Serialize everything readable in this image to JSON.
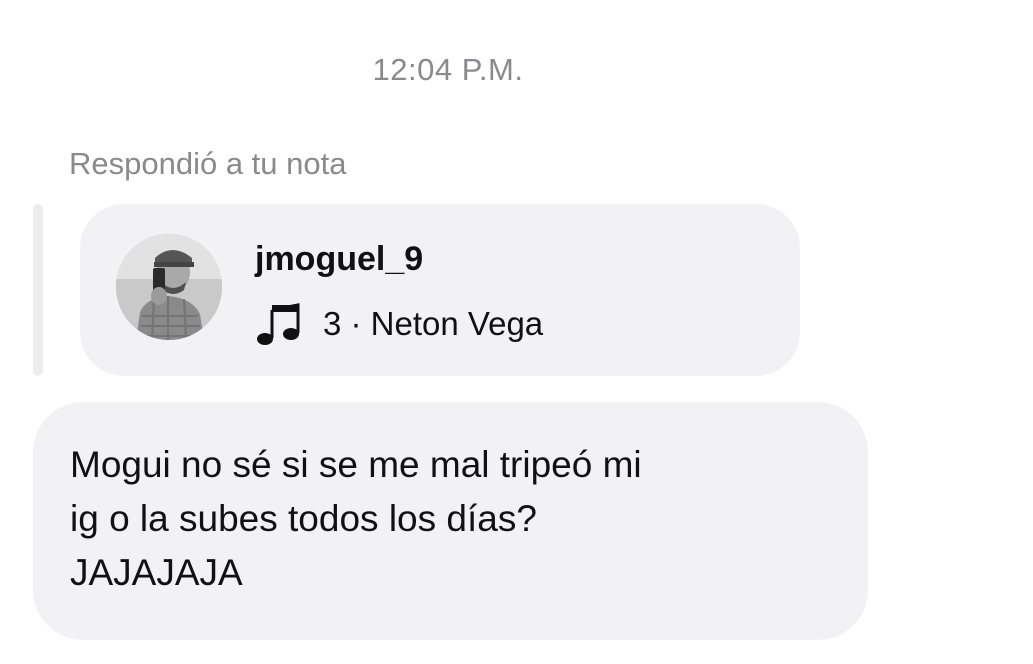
{
  "thread": {
    "timestamp": "12:04 P.M.",
    "reply_context": "Respondió a tu nota"
  },
  "note": {
    "username": "jmoguel_9",
    "music_icon": "musical-note-icon",
    "music_text": "3 · Neton Vega"
  },
  "message": {
    "text": "Mogui no sé si se me mal tripeó mi\nig o la subes todos los días?\nJAJAJAJA"
  },
  "colors": {
    "bubble_background": "#f2f2f5",
    "secondary_text": "#8a8a8e",
    "primary_text": "#111111"
  }
}
